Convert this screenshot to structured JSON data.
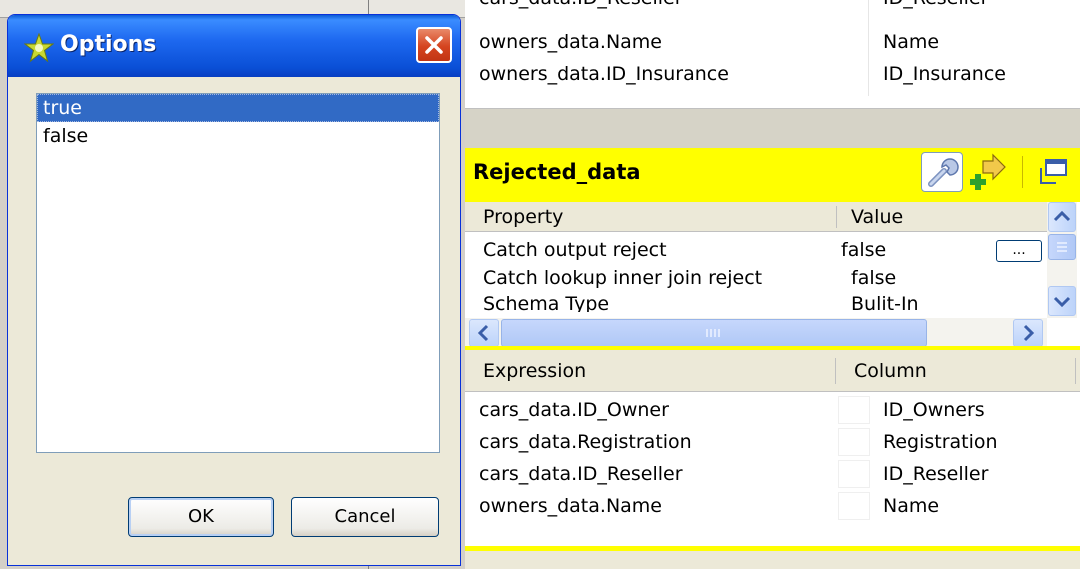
{
  "dialog": {
    "title": "Options",
    "options": [
      "true",
      "false"
    ],
    "selected_index": 0,
    "ok_label": "OK",
    "cancel_label": "Cancel"
  },
  "top_table": {
    "rows": [
      {
        "expression": "cars_data.ID_Reseller",
        "column": "ID_Reseller"
      },
      {
        "expression": "owners_data.Name",
        "column": "Name"
      },
      {
        "expression": "owners_data.ID_Insurance",
        "column": "ID_Insurance"
      }
    ]
  },
  "rejected": {
    "title": "Rejected_data",
    "property_header": "Property",
    "value_header": "Value",
    "properties": [
      {
        "property": "Catch output reject",
        "value": "false"
      },
      {
        "property": "Catch lookup inner join reject",
        "value": "false"
      },
      {
        "property": "Schema Type",
        "value": "Bulit-In"
      }
    ],
    "ellipsis_label": "...",
    "expression_header": "Expression",
    "column_header": "Column",
    "rows": [
      {
        "expression": "cars_data.ID_Owner",
        "column": "ID_Owners"
      },
      {
        "expression": "cars_data.Registration",
        "column": "Registration"
      },
      {
        "expression": "cars_data.ID_Reseller",
        "column": "ID_Reseller"
      },
      {
        "expression": "owners_data.Name",
        "column": "Name"
      }
    ]
  },
  "colors": {
    "titlebar_blue": "#0a4fd6",
    "selection": "#316ac5",
    "header_yellow": "#ffff00",
    "close_red": "#d5441f"
  },
  "icons": {
    "dialog": "star-icon",
    "close": "close-icon",
    "settings": "wrench-icon",
    "add": "add-arrow-icon",
    "restore": "restore-icon"
  }
}
